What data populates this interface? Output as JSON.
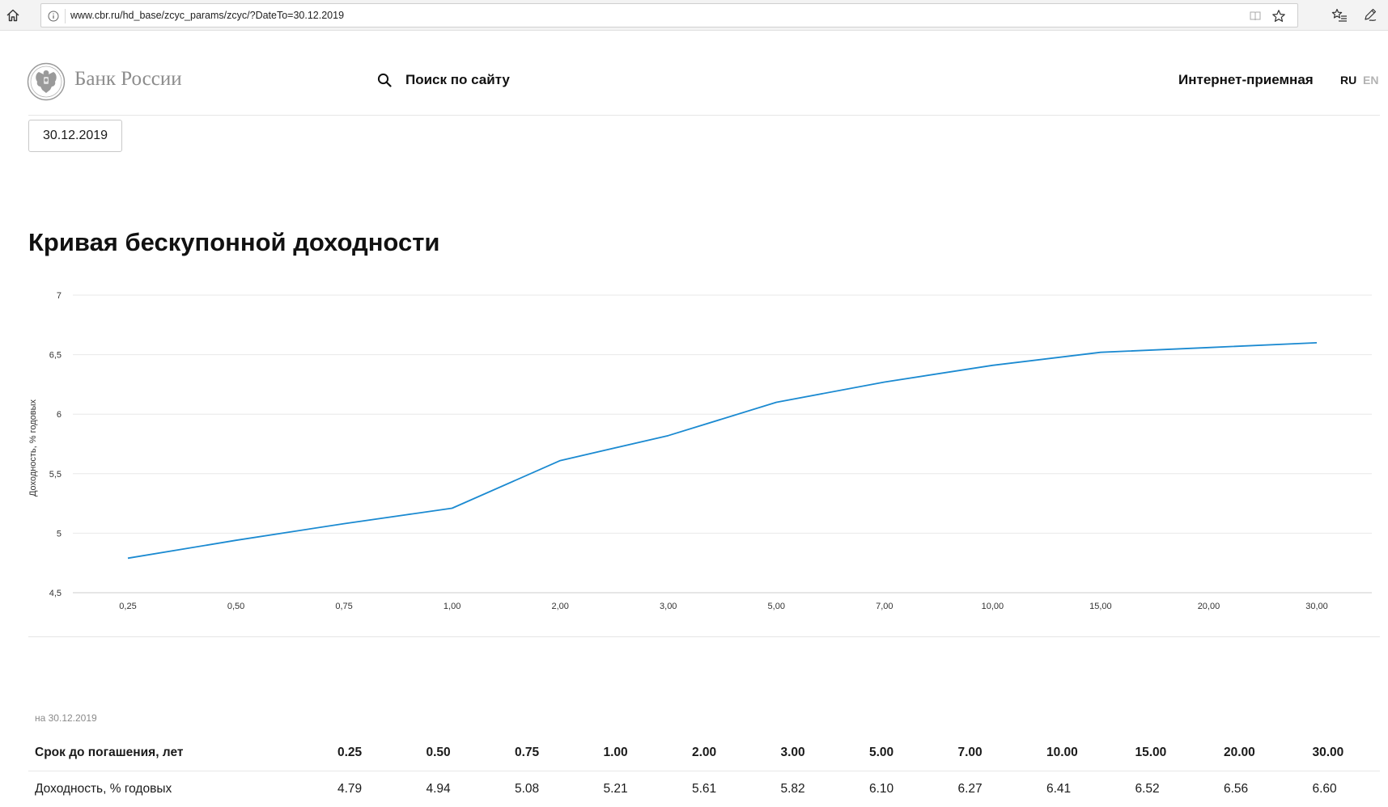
{
  "browser": {
    "url": "www.cbr.ru/hd_base/zcyc_params/zcyc/?DateTo=30.12.2019"
  },
  "header": {
    "brand": "Банк России",
    "search_label": "Поиск по сайту",
    "reception": "Интернет-приемная",
    "lang_ru": "RU",
    "lang_en": "EN"
  },
  "date_filter": {
    "value": "30.12.2019"
  },
  "page_title": "Кривая бескупонной доходности",
  "chart_data": {
    "type": "line",
    "title": "",
    "ylabel": "Доходность, % годовых",
    "xlabel": "",
    "categories": [
      "0,25",
      "0,50",
      "0,75",
      "1,00",
      "2,00",
      "3,00",
      "5,00",
      "7,00",
      "10,00",
      "15,00",
      "20,00",
      "30,00"
    ],
    "series": [
      {
        "values": [
          4.79,
          4.94,
          5.08,
          5.21,
          5.61,
          5.82,
          6.1,
          6.27,
          6.41,
          6.52,
          6.56,
          6.6
        ]
      }
    ],
    "ylim": [
      4.5,
      7
    ],
    "yticks": [
      "4,5",
      "5",
      "5,5",
      "6",
      "6,5",
      "7"
    ],
    "grid": true,
    "line_color": "#1b8ad1"
  },
  "table": {
    "as_of": "на 30.12.2019",
    "header_label": "Срок до погашения, лет",
    "row_label": "Доходность, % годовых",
    "terms": [
      "0.25",
      "0.50",
      "0.75",
      "1.00",
      "2.00",
      "3.00",
      "5.00",
      "7.00",
      "10.00",
      "15.00",
      "20.00",
      "30.00"
    ],
    "yields": [
      "4.79",
      "4.94",
      "5.08",
      "5.21",
      "5.61",
      "5.82",
      "6.10",
      "6.27",
      "6.41",
      "6.52",
      "6.56",
      "6.60"
    ]
  }
}
